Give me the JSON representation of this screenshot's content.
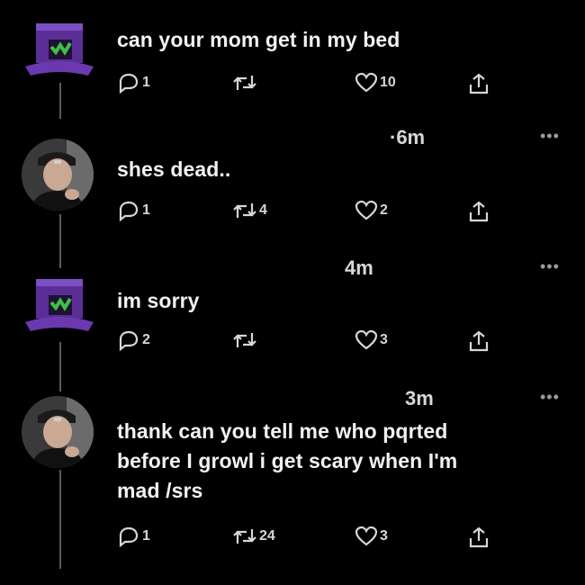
{
  "posts": [
    {
      "text": "can your mom get in my bed",
      "timestamp": "",
      "replies": "1",
      "retweets": "",
      "likes": "10"
    },
    {
      "text": "shes dead..",
      "timestamp": "·6m",
      "replies": "1",
      "retweets": "4",
      "likes": "2"
    },
    {
      "text": "im sorry",
      "timestamp": "4m",
      "replies": "2",
      "retweets": "",
      "likes": "3"
    },
    {
      "text": "thank can you tell me who pqrted before I growl i get scary when I'm mad /srs",
      "timestamp": "3m",
      "replies": "1",
      "retweets": "24",
      "likes": "3"
    }
  ],
  "icons": {
    "reply": "reply-icon",
    "retweet": "retweet-icon",
    "like": "heart-icon",
    "share": "share-icon",
    "more": "more-options-icon"
  },
  "more_label": "•••",
  "colors": {
    "background": "#000000",
    "thread_line": "#5a5a5a",
    "avatar_purple": "#5b2e97",
    "avatar_green": "#3fbf4a"
  }
}
